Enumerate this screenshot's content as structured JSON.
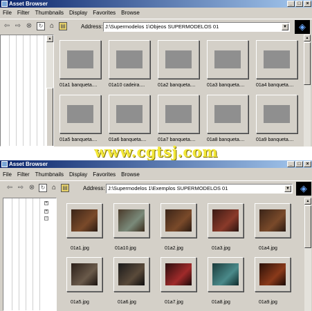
{
  "watermark": "www.cgtsj.com",
  "windows": [
    {
      "title": "Asset Browser",
      "menu": [
        "File",
        "Filter",
        "Thumbnails",
        "Display",
        "Favorites",
        "Browse"
      ],
      "address_label": "Address:",
      "address": "J:\\Supermodelos 1\\Objeos SUPERMODELOS 01",
      "thumbs": [
        {
          "label": "01a1 banqueta....",
          "kind": "gray"
        },
        {
          "label": "01a10 cadeira....",
          "kind": "gray"
        },
        {
          "label": "01a2 banqueta....",
          "kind": "gray"
        },
        {
          "label": "01a3 banqueta....",
          "kind": "gray"
        },
        {
          "label": "01a4 banqueta....",
          "kind": "gray"
        },
        {
          "label": "01a5 banqueta....",
          "kind": "gray"
        },
        {
          "label": "01a6 banqueta....",
          "kind": "gray"
        },
        {
          "label": "01a7 banqueta....",
          "kind": "gray"
        },
        {
          "label": "01a8 banqueta....",
          "kind": "gray"
        },
        {
          "label": "01a9 banqueta....",
          "kind": "gray"
        }
      ]
    },
    {
      "title": "Asset Browser",
      "menu": [
        "File",
        "Filter",
        "Thumbnails",
        "Display",
        "Favorites",
        "Browse"
      ],
      "address_label": "Address:",
      "address": "J:\\Supermodelos 1\\Exemplos SUPERMODELOS 01",
      "thumbs": [
        {
          "label": "01a1.jpg",
          "kind": "photo"
        },
        {
          "label": "01a10.jpg",
          "kind": "photo"
        },
        {
          "label": "01a2.jpg",
          "kind": "photo"
        },
        {
          "label": "01a3.jpg",
          "kind": "photo"
        },
        {
          "label": "01a4.jpg",
          "kind": "photo"
        },
        {
          "label": "01a5.jpg",
          "kind": "photo"
        },
        {
          "label": "01a6.jpg",
          "kind": "photo"
        },
        {
          "label": "01a7.jpg",
          "kind": "photo"
        },
        {
          "label": "01a8.jpg",
          "kind": "photo"
        },
        {
          "label": "01a9.jpg",
          "kind": "photo"
        }
      ]
    }
  ]
}
